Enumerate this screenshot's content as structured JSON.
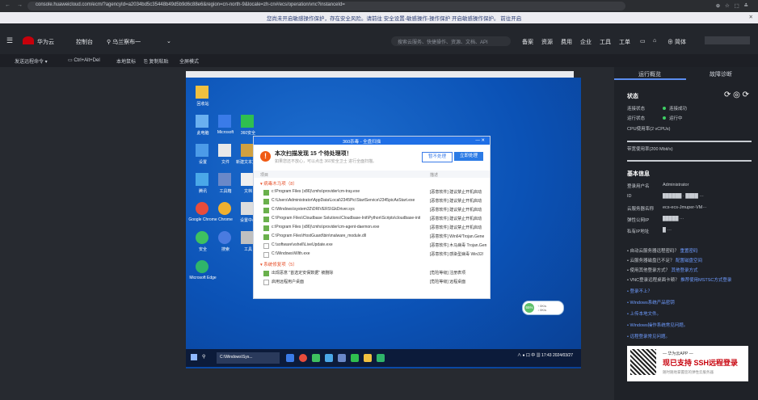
{
  "browser": {
    "nav": "← → C",
    "url": "console.huaweicloud.com/ecm/?agencyId=a2034bd5c35448b49d5b9d6c88e6&region=cn-north-9&locale=zh-cn#/ecs/operation/vnc?instanceId=",
    "right": "⊕ ☆ ⬚ ≛"
  },
  "notice": {
    "text": "您尚未开启敏感操作保护，存在安全风险。请前往 安全设置-敏感操作-操作保护 开启敏感操作保护。 前往开启",
    "close": "✕"
  },
  "header": {
    "brand": "华为云",
    "console": "控制台",
    "region": "乌兰察布一",
    "search_placeholder": "搜索云服务、快捷操作、资源、文档、API",
    "nav": [
      "备案",
      "资源",
      "费用",
      "企业",
      "工具",
      "工单"
    ],
    "user": "⊕ 简体"
  },
  "toolbar": {
    "items": [
      "发送远程命令 ▾",
      "Ctrl+Alt+Del",
      "本地鼠标",
      "复制粘贴",
      "全屏模式"
    ]
  },
  "desktop": {
    "icons": [
      {
        "label": "回收站",
        "color": "#f0c040"
      },
      {
        "label": "此电脑",
        "color": "#6ab0f0"
      },
      {
        "label": "Microsoft",
        "color": "#3a7be8"
      },
      {
        "label": "360安全",
        "color": "#2fbf4f"
      },
      {
        "label": "设置",
        "color": "#4c9be8"
      },
      {
        "label": "文件",
        "color": "#e8e8e8"
      },
      {
        "label": "新建文本文档",
        "color": "#d0a040"
      },
      {
        "label": "腾讯",
        "color": "#4aa8e8"
      },
      {
        "label": "工具箱",
        "color": "#6a88c8"
      },
      {
        "label": "文档",
        "color": "#f0f0f0"
      },
      {
        "label": "Google Chrome",
        "color": "#e84c3c"
      },
      {
        "label": "Chrome",
        "color": "#f0b030"
      },
      {
        "label": "设置中心",
        "color": "#ddd"
      },
      {
        "label": "安全",
        "color": "#3ec060"
      },
      {
        "label": "搜索",
        "color": "#4a7be0"
      },
      {
        "label": "工具",
        "color": "#c0c0c0"
      },
      {
        "label": "Microsoft Edge",
        "color": "#2fb56a"
      }
    ],
    "taskbar_app": "C:\\Windows\\Sys...",
    "tray": "∧ ● 口 中 ▦  17:43  2024/03/27"
  },
  "dialog": {
    "title": "360杀毒 - 全盘扫描",
    "close": "— ✕",
    "heading": "本次扫描发现 15 个待处理项！",
    "subtitle": "如果您还不放心，可以点击 360安全卫士 进行全面扫描。",
    "ignore_button": "暂不处理",
    "process_button": "立即处理",
    "col_item": "项目",
    "col_desc": "描述",
    "section1": "▾ 病毒木马项（8）",
    "section2": "▾ 系统修复项（5）",
    "rows1": [
      {
        "path": "c:\\Program Files (x86)\\cmhs\\provider\\cm-tray.exe",
        "desc": "[恶意软件] 建议禁止开机启动",
        "checked": true
      },
      {
        "path": "C:\\Users\\Administrator\\AppData\\Local\\2345Pic\\StartService\\2345picAsStart.exe",
        "desc": "[恶意软件] 建议禁止开机启动",
        "checked": true
      },
      {
        "path": "C:\\Windows\\system32\\DRIVERS\\GkDriver.sys",
        "desc": "[恶意软件] 建议禁止开机启动",
        "checked": true
      },
      {
        "path": "C:\\Program Files\\Cloudbase Solutions\\Cloudbase-Init\\Python\\Scripts\\cloudbase-init.exe",
        "desc": "[恶意软件] 建议禁止开机启动",
        "checked": true
      },
      {
        "path": "c:\\Program Files (x86)\\cmhs\\provider\\cm-agent-daemon.exe",
        "desc": "[恶意软件] 建议禁止开机启动",
        "checked": true
      },
      {
        "path": "C:\\Program Files\\HostGuard\\bin\\malware_module.dll",
        "desc": "[恶意软件] Win64/Trojan.Gene",
        "checked": true
      },
      {
        "path": "C:\\software\\vshell\\LiveUpdate.exe",
        "desc": "[恶意软件] 木马病毒 Trojan.Gen",
        "checked": false
      },
      {
        "path": "C:\\Windows\\Wlth.exe",
        "desc": "[恶意软件] 感染型病毒 Win32/",
        "checked": false
      }
    ],
    "rows2": [
      {
        "path": "出现恶意 \"首选定安保数据\" 被删除",
        "desc": "[危险等级] 注册表项",
        "checked": true
      },
      {
        "path": "启用远程用户桌面",
        "desc": "[危险等级] 远程桌面",
        "checked": false
      }
    ]
  },
  "widget": {
    "percent": "65%",
    "line1": "↑ 0K/s",
    "line2": "↓ 0K/s"
  },
  "panel": {
    "tab_active": "运行概览",
    "tab_other": "故障诊断",
    "status_title": "状态",
    "refresh_icons": "⟳ ◎ ⟳",
    "conn_label": "连接状态",
    "conn_value": "连接成功",
    "run_label": "运行状态",
    "run_value": "运行中",
    "cpu_label": "CPU使用率(2 vCPUs)",
    "net_label": "带宽使用率(200 Mbit/s)",
    "info_title": "基本信息",
    "rows": [
      {
        "k": "登录用户名",
        "v": "Administrator"
      },
      {
        "k": "ID",
        "v": "██████ ·  ████ ···"
      },
      {
        "k": "云服务器名称",
        "v": "ecs-ecs-Jmuper-VM···"
      },
      {
        "k": "弹性公网IP",
        "v": "█████ ···"
      },
      {
        "k": "私有IP地址",
        "v": "█ ···"
      }
    ],
    "links": [
      {
        "q": "• 自动云服务器远程密码？",
        "a": "重置密码"
      },
      {
        "q": "• 云服务器磁盘已不足？",
        "a": "配置磁盘空间"
      },
      {
        "q": "• 使用其他登录方式？",
        "a": "其他登录方式"
      },
      {
        "q": "• VNC登录远程桌面卡顿？",
        "a": "推荐使用MSTSC方式登录"
      },
      {
        "q": "• 登录不上？",
        "a": ""
      },
      {
        "q": "• Windows系统产品密钥",
        "a": ""
      },
      {
        "q": "• 上传本地文件。",
        "a": ""
      },
      {
        "q": "• Windows操作系统常见问题。",
        "a": ""
      },
      {
        "q": "• 远程登录常见问题。",
        "a": ""
      }
    ],
    "promo_l1": "— 华为云APP —",
    "promo_l2": "现已支持 SSH远程登录",
    "promo_l3": "随时随地掌握您的弹性云服务器"
  }
}
